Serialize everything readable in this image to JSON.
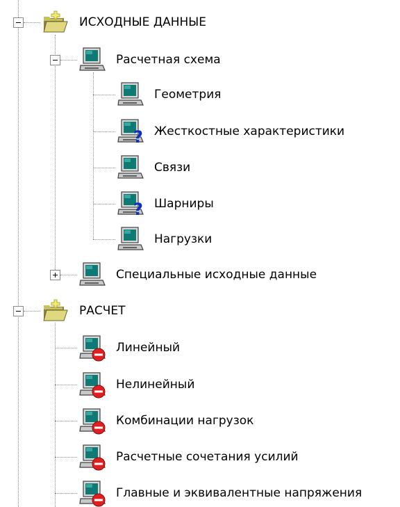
{
  "tree": {
    "groups": [
      {
        "label": "ИСХОДНЫЕ ДАННЫЕ",
        "expanded": true,
        "icon": "open-folder-icon",
        "children": [
          {
            "label": "Расчетная схема",
            "expanded": true,
            "icon": "computer-icon",
            "children": [
              {
                "label": "Геометрия",
                "icon": "computer-icon"
              },
              {
                "label": "Жесткостные характеристики",
                "icon": "computer-question-icon"
              },
              {
                "label": "Связи",
                "icon": "computer-icon"
              },
              {
                "label": "Шарниры",
                "icon": "computer-question-icon"
              },
              {
                "label": "Нагрузки",
                "icon": "computer-icon"
              }
            ]
          },
          {
            "label": "Специальные исходные данные",
            "expanded": false,
            "icon": "computer-icon"
          }
        ]
      },
      {
        "label": "РАСЧЕТ",
        "expanded": true,
        "icon": "open-folder-icon",
        "children": [
          {
            "label": "Линейный",
            "icon": "computer-stop-icon"
          },
          {
            "label": "Нелинейный",
            "icon": "computer-stop-icon"
          },
          {
            "label": "Комбинации нагрузок",
            "icon": "computer-stop-icon"
          },
          {
            "label": "Расчетные сочетания усилий",
            "icon": "computer-stop-icon"
          },
          {
            "label": "Главные и эквивалентные напряжения",
            "icon": "computer-stop-icon"
          }
        ]
      }
    ]
  },
  "colors": {
    "folder_body": "#c8c060",
    "folder_light": "#f0e8a0",
    "screen": "#0f7a74",
    "screen_frame": "#d8d8d8",
    "question": "#1030c0",
    "stop": "#e02020"
  }
}
